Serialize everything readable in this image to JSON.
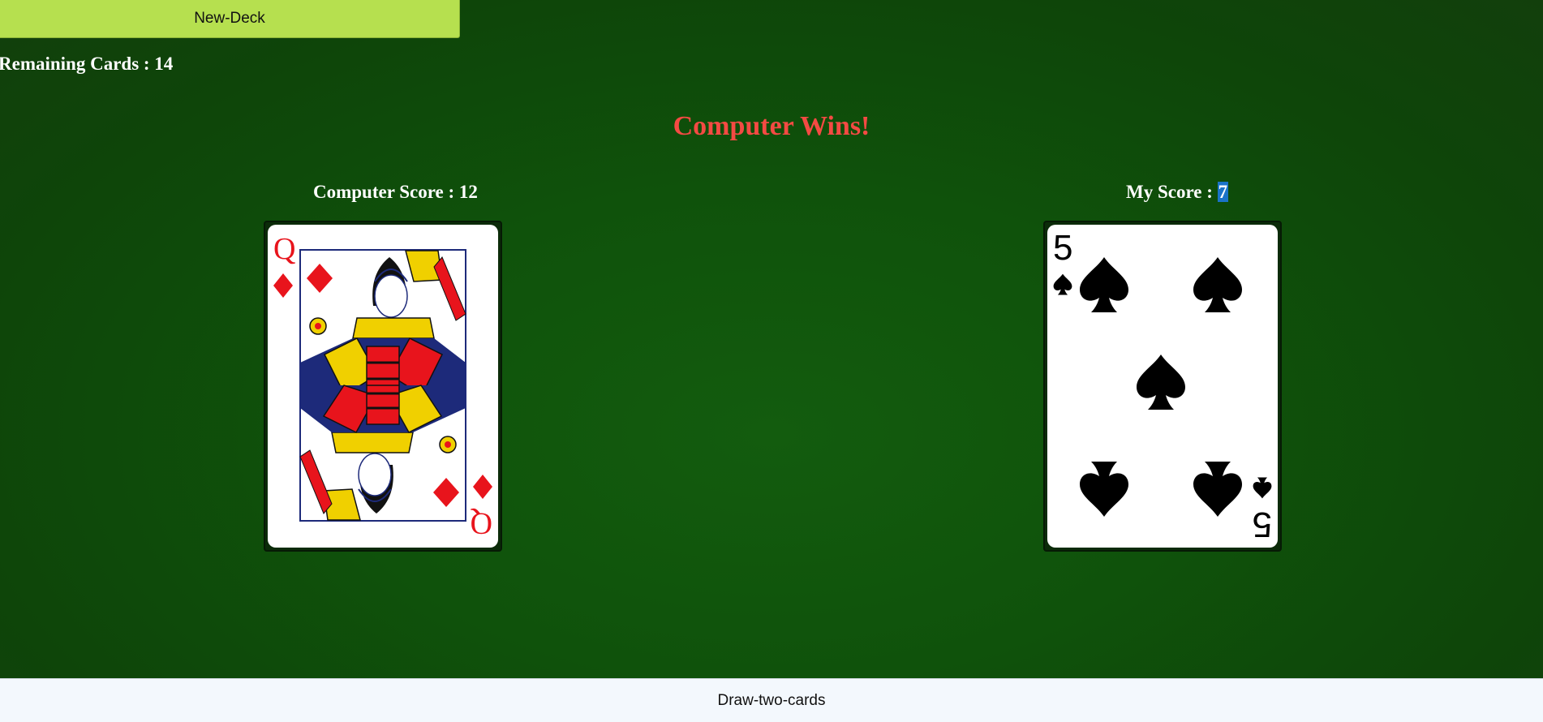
{
  "controls": {
    "new_deck_label": "New-Deck",
    "draw_label": "Draw-two-cards"
  },
  "status": {
    "remaining_label": "Remaining Cards : 14",
    "result_text": "Computer Wins!"
  },
  "scores": {
    "computer_label": "Computer Score : 12",
    "my_label_prefix": "My Score : ",
    "my_value": "7"
  },
  "cards": {
    "computer": {
      "rank": "Q",
      "suit": "diamonds",
      "color": "#e8141c"
    },
    "player": {
      "rank": "5",
      "suit": "spades",
      "color": "#000000"
    }
  },
  "colors": {
    "table_green": "#135c0e",
    "result_red": "#f44a43",
    "new_deck_green": "#b6e04f",
    "selection_blue": "#1a73c8"
  }
}
